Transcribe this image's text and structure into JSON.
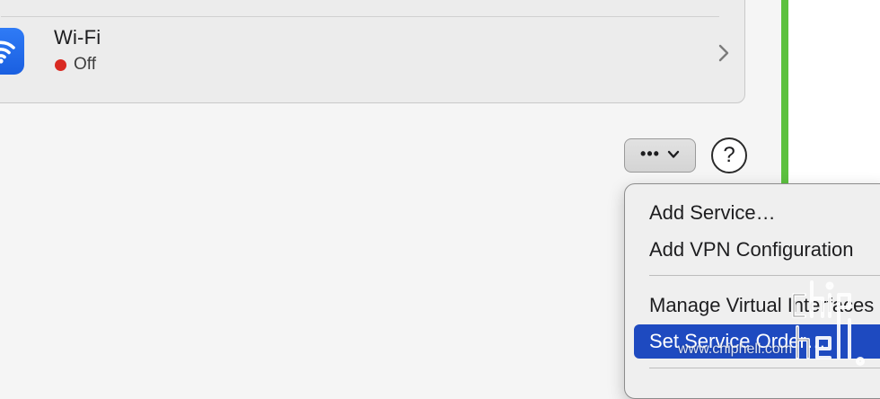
{
  "network_services": {
    "wifi": {
      "name": "Wi-Fi",
      "status": "Off",
      "status_color": "#d92a22",
      "icon": "wifi-icon",
      "icon_color": "#2f7bf6",
      "chevron_icon": "chevron-right-icon"
    }
  },
  "toolbar": {
    "more_button_label": "•••",
    "more_button_icon": "chevron-down-icon",
    "help_button_label": "?"
  },
  "context_menu": {
    "items": [
      {
        "label": "Add Service…",
        "selected": false
      },
      {
        "label": "Add VPN Configuration",
        "selected": false
      },
      {
        "label": "Manage Virtual Interfaces",
        "selected": false
      },
      {
        "label": "Set Service Order…",
        "selected": true
      }
    ],
    "selection_color": "#1e4ac0"
  },
  "watermark": {
    "text": "www.chiphell.com",
    "logo": "chiphell-logo"
  },
  "colors": {
    "window_accent_green": "#5cc13f"
  }
}
